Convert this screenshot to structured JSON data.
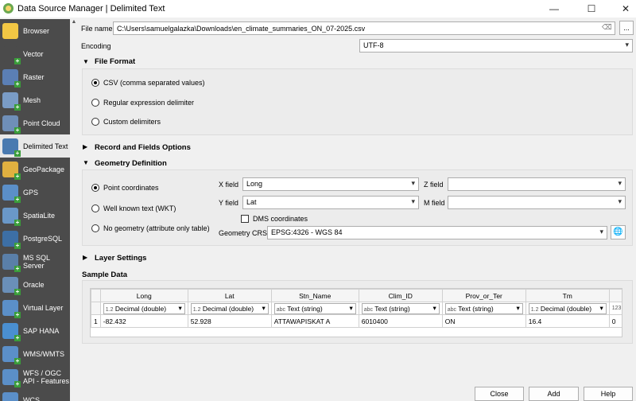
{
  "window": {
    "title": "Data Source Manager | Delimited Text",
    "minimize": "—",
    "maximize": "☐",
    "close": "✕"
  },
  "sidebar": {
    "items": [
      {
        "label": "Browser",
        "color": "#f2c744"
      },
      {
        "label": "Vector",
        "color": "#4b4b4b"
      },
      {
        "label": "Raster",
        "color": "#5b7fb5"
      },
      {
        "label": "Mesh",
        "color": "#7a9cc6"
      },
      {
        "label": "Point Cloud",
        "color": "#6f8fb8"
      },
      {
        "label": "Delimited Text",
        "color": "#4a7ab0"
      },
      {
        "label": "GeoPackage",
        "color": "#e0b040"
      },
      {
        "label": "GPS",
        "color": "#5b8fc8"
      },
      {
        "label": "SpatiaLite",
        "color": "#6a98c8"
      },
      {
        "label": "PostgreSQL",
        "color": "#3d6fa5"
      },
      {
        "label": "MS SQL Server",
        "color": "#5a7fa8"
      },
      {
        "label": "Oracle",
        "color": "#6a8fb8"
      },
      {
        "label": "Virtual Layer",
        "color": "#5b8fc8"
      },
      {
        "label": "SAP HANA",
        "color": "#4a8fd0"
      },
      {
        "label": "WMS/WMTS",
        "color": "#5b8fc8"
      },
      {
        "label": "WFS / OGC API - Features",
        "color": "#5b8fc8"
      },
      {
        "label": "WCS",
        "color": "#5b8fc8"
      }
    ]
  },
  "file": {
    "label": "File name",
    "value": "C:\\Users\\samuelgalazka\\Downloads\\en_climate_summaries_ON_07-2025.csv",
    "browse": "..."
  },
  "encoding": {
    "label": "Encoding",
    "value": "UTF-8"
  },
  "file_format": {
    "title": "File Format",
    "options": [
      "CSV (comma separated values)",
      "Regular expression delimiter",
      "Custom delimiters"
    ]
  },
  "record_fields": {
    "title": "Record and Fields Options"
  },
  "geometry": {
    "title": "Geometry Definition",
    "options": [
      "Point coordinates",
      "Well known text (WKT)",
      "No geometry (attribute only table)"
    ],
    "x_label": "X field",
    "x_value": "Long",
    "y_label": "Y field",
    "y_value": "Lat",
    "z_label": "Z field",
    "z_value": "",
    "m_label": "M field",
    "m_value": "",
    "dms": "DMS coordinates",
    "crs_label": "Geometry CRS",
    "crs_value": "EPSG:4326 - WGS 84"
  },
  "layer_settings": {
    "title": "Layer Settings"
  },
  "sample": {
    "title": "Sample Data",
    "columns": [
      {
        "name": "Long",
        "type": "Decimal (double)",
        "prefix": "1.2"
      },
      {
        "name": "Lat",
        "type": "Decimal (double)",
        "prefix": "1.2"
      },
      {
        "name": "Stn_Name",
        "type": "Text (string)",
        "prefix": "abc"
      },
      {
        "name": "Clim_ID",
        "type": "Text (string)",
        "prefix": "abc"
      },
      {
        "name": "Prov_or_Ter",
        "type": "Text (string)",
        "prefix": "abc"
      },
      {
        "name": "Tm",
        "type": "Decimal (double)",
        "prefix": "1.2"
      },
      {
        "name": "",
        "type": "",
        "prefix": "123"
      }
    ],
    "rows": [
      {
        "num": "1",
        "cells": [
          "-82.432",
          "52.928",
          "ATTAWAPISKAT A",
          "6010400",
          "ON",
          "16.4",
          "0"
        ]
      }
    ]
  },
  "buttons": {
    "close": "Close",
    "add": "Add",
    "help": "Help"
  }
}
